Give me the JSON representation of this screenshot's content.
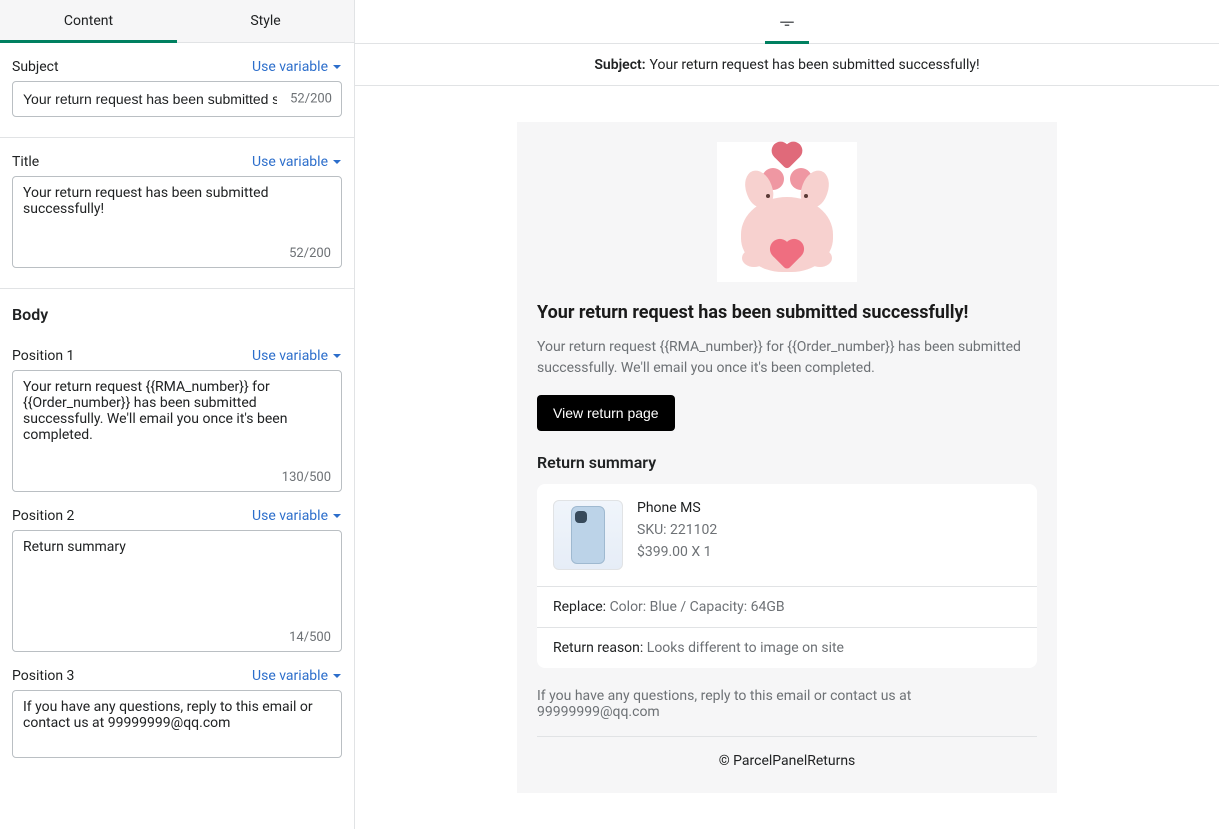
{
  "tabs": {
    "content": "Content",
    "style": "Style"
  },
  "use_variable_label": "Use variable",
  "subject": {
    "label": "Subject",
    "value": "Your return request has been submitted successfully!",
    "counter": "52/200"
  },
  "title": {
    "label": "Title",
    "value": "Your return request has been submitted successfully!",
    "counter": "52/200"
  },
  "body_heading": "Body",
  "position1": {
    "label": "Position 1",
    "value": "Your return request {{RMA_number}} for {{Order_number}} has been submitted successfully. We'll email you once it's been completed.",
    "counter": "130/500"
  },
  "position2": {
    "label": "Position 2",
    "value": "Return summary",
    "counter": "14/500"
  },
  "position3": {
    "label": "Position 3",
    "value": "If you have any questions, reply to this email or contact us at 99999999@qq.com"
  },
  "preview": {
    "subject_prefix": "Subject:",
    "subject_text": "Your return request has been submitted successfully!",
    "title": "Your return request has been submitted successfully!",
    "intro": "Your return request {{RMA_number}} for {{Order_number}} has been submitted successfully. We'll email you once it's been completed.",
    "cta": "View return page",
    "summary_heading": "Return summary",
    "product": {
      "name": "Phone MS",
      "sku": "SKU: 221102",
      "price": "$399.00 X 1"
    },
    "replace_label": "Replace:",
    "replace_value": "Color: Blue / Capacity: 64GB",
    "reason_label": "Return reason:",
    "reason_value": "Looks different to image on site",
    "footer_note": "If you have any questions, reply to this email or contact us at 99999999@qq.com",
    "copyright": "© ParcelPanelReturns"
  }
}
